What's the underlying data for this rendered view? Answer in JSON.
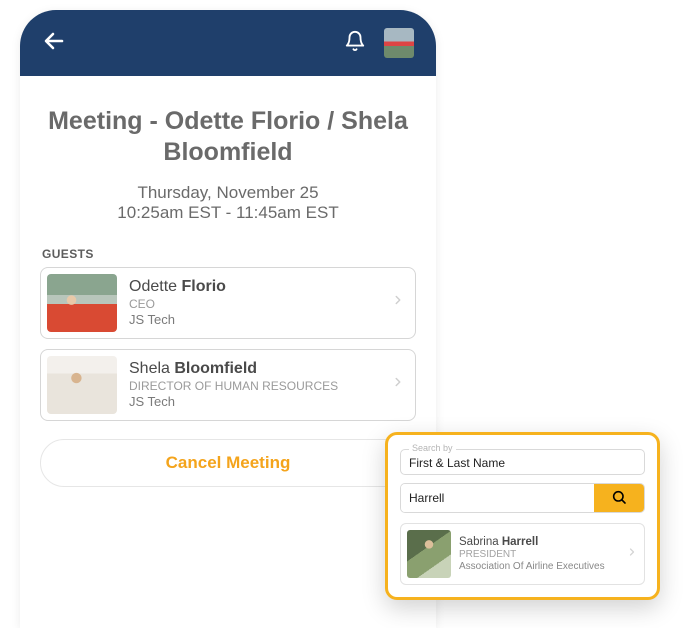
{
  "header": {
    "back_icon": "arrow-left",
    "bell_icon": "bell"
  },
  "meeting": {
    "title": "Meeting - Odette Florio / Shela Bloomfield",
    "date": "Thursday, November 25",
    "time": "10:25am EST - 11:45am EST"
  },
  "guests_label": "GUESTS",
  "guests": [
    {
      "first": "Odette",
      "last": "Florio",
      "role": "CEO",
      "company": "JS Tech"
    },
    {
      "first": "Shela",
      "last": "Bloomfield",
      "role": "DIRECTOR OF HUMAN RESOURCES",
      "company": "JS Tech"
    }
  ],
  "cancel_label": "Cancel Meeting",
  "search": {
    "legend": "Search by",
    "mode": "First & Last Name",
    "query": "Harrell",
    "result": {
      "first": "Sabrina",
      "last": "Harrell",
      "role": "PRESIDENT",
      "org": "Association Of Airline Executives"
    }
  },
  "colors": {
    "header_bg": "#1f3f6b",
    "accent": "#f6b21e",
    "cancel_text": "#f4a41c"
  }
}
